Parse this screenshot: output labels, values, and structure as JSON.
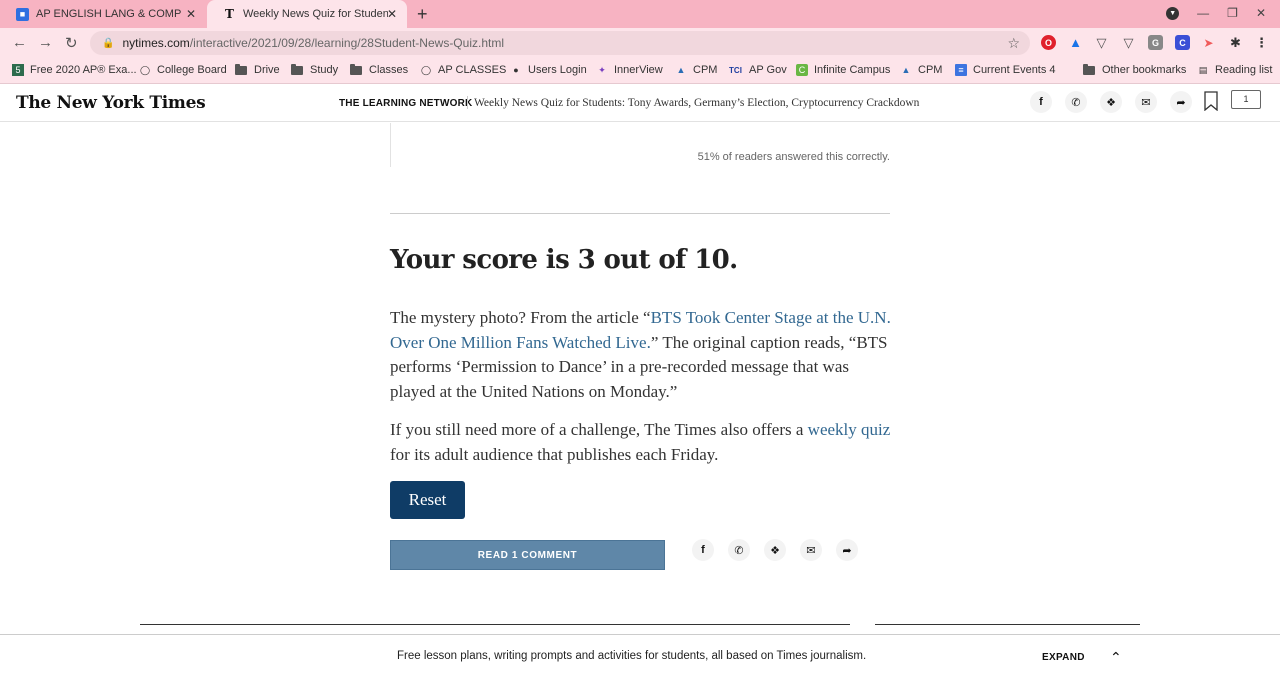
{
  "browser": {
    "tabs": [
      {
        "label": "AP ENGLISH LANG & COMPOSITI",
        "active": false,
        "icon": "classroom-icon"
      },
      {
        "label": "Weekly News Quiz for Students:",
        "active": true,
        "icon": "nyt-icon"
      }
    ],
    "url_domain": "nytimes.com",
    "url_path": "/interactive/2021/09/28/learning/28Student-News-Quiz.html",
    "bookmarks": [
      {
        "label": "Free 2020 AP® Exa..."
      },
      {
        "label": "College Board"
      },
      {
        "label": "Drive"
      },
      {
        "label": "Study"
      },
      {
        "label": "Classes"
      },
      {
        "label": "AP CLASSES"
      },
      {
        "label": "Users Login"
      },
      {
        "label": "InnerView"
      },
      {
        "label": "CPM"
      },
      {
        "label": "AP Gov"
      },
      {
        "label": "Infinite Campus"
      },
      {
        "label": "CPM"
      },
      {
        "label": "Current Events 4"
      },
      {
        "label": "Other bookmarks"
      },
      {
        "label": "Reading list"
      }
    ]
  },
  "header": {
    "logo": "The New York Times",
    "section": "THE LEARNING NETWORK",
    "title": "Weekly News Quiz for Students: Tony Awards, Germany’s Election, Cryptocurrency Crackdown",
    "comment_count": "1"
  },
  "article": {
    "percent_correct": "51% of readers answered this correctly.",
    "score": "Your score is 3 out of 10.",
    "p1_before": "The mystery photo? From the article “",
    "p1_link": "BTS Took Center Stage at the U.N. Over One Million Fans Watched Live.",
    "p1_after": "” The original caption reads, “BTS performs ‘Permission to Dance’ in a pre-recorded message that was played at the United Nations on Monday.”",
    "p2_before": "If you still need more of a challenge, The Times also offers a ",
    "p2_link": "weekly quiz",
    "p2_after": " for its adult audience that publishes each Friday.",
    "reset_label": "Reset",
    "read_comment_label": "READ 1 COMMENT"
  },
  "footer": {
    "text": "Free lesson plans, writing prompts and activities for students, all based on Times journalism.",
    "expand_label": "EXPAND"
  }
}
